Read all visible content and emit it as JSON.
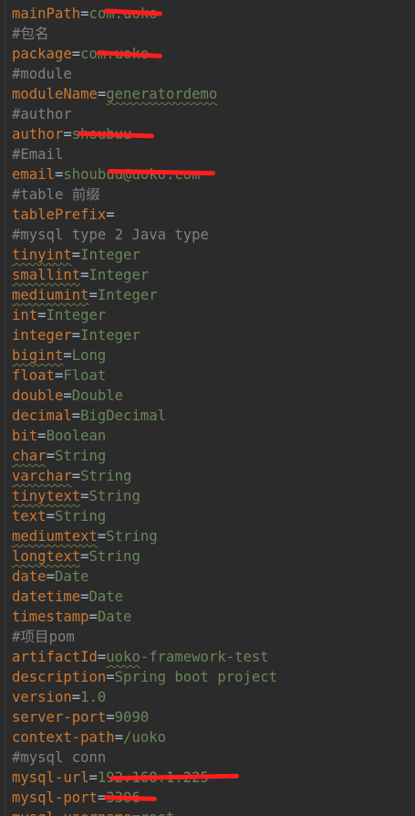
{
  "editor": {
    "lines": [
      {
        "key": "mainPath",
        "value": "com.uoko"
      },
      {
        "comment": "#包名"
      },
      {
        "key": "package",
        "value": "com.uoko"
      },
      {
        "comment": "#module"
      },
      {
        "key": "moduleName",
        "value": "generatordemo",
        "value_typo": true
      },
      {
        "comment": "#author"
      },
      {
        "key": "author",
        "value": "shoubuu"
      },
      {
        "comment": "#Email"
      },
      {
        "key": "email",
        "value": "shoubuu@uoko.com"
      },
      {
        "comment": "#table 前缀"
      },
      {
        "key": "tablePrefix",
        "value": ""
      },
      {
        "comment": "#mysql type 2 Java type"
      },
      {
        "key": "tinyint",
        "value": "Integer",
        "key_typo": true
      },
      {
        "key": "smallint",
        "value": "Integer",
        "key_typo": true
      },
      {
        "key": "mediumint",
        "value": "Integer",
        "key_typo": true
      },
      {
        "key": "int",
        "value": "Integer"
      },
      {
        "key": "integer",
        "value": "Integer"
      },
      {
        "key": "bigint",
        "value": "Long",
        "key_typo": true
      },
      {
        "key": "float",
        "value": "Float"
      },
      {
        "key": "double",
        "value": "Double"
      },
      {
        "key": "decimal",
        "value": "BigDecimal"
      },
      {
        "key": "bit",
        "value": "Boolean"
      },
      {
        "key": "char",
        "value": "String",
        "key_typo": true
      },
      {
        "key": "varchar",
        "value": "String",
        "key_typo": true
      },
      {
        "key": "tinytext",
        "value": "String",
        "key_typo": true
      },
      {
        "key": "text",
        "value": "String"
      },
      {
        "key": "mediumtext",
        "value": "String",
        "key_typo": true
      },
      {
        "key": "longtext",
        "value": "String",
        "key_typo": true
      },
      {
        "key": "date",
        "value": "Date"
      },
      {
        "key": "datetime",
        "value": "Date"
      },
      {
        "key": "timestamp",
        "value": "Date"
      },
      {
        "comment": "#项目pom"
      },
      {
        "key": "artifactId",
        "value": "uoko-framework-test",
        "value_typo_prefix": "uoko"
      },
      {
        "key": "description",
        "value": "Spring boot project"
      },
      {
        "key": "version",
        "value": "1.0"
      },
      {
        "key": "server-port",
        "value": "9090"
      },
      {
        "key": "context-path",
        "value": "/uoko"
      },
      {
        "comment": "#mysql conn"
      },
      {
        "key": "mysql-url",
        "value": "192.168.1.225"
      },
      {
        "key": "mysql-port",
        "value": "3306"
      },
      {
        "key": "mysql-username",
        "value": "root"
      }
    ],
    "colors": {
      "background": "#2b2b2b",
      "key": "#cc7832",
      "value": "#6a8759",
      "comment": "#808080",
      "plain": "#a9b7c6",
      "redaction": "#ff1e1e"
    }
  }
}
